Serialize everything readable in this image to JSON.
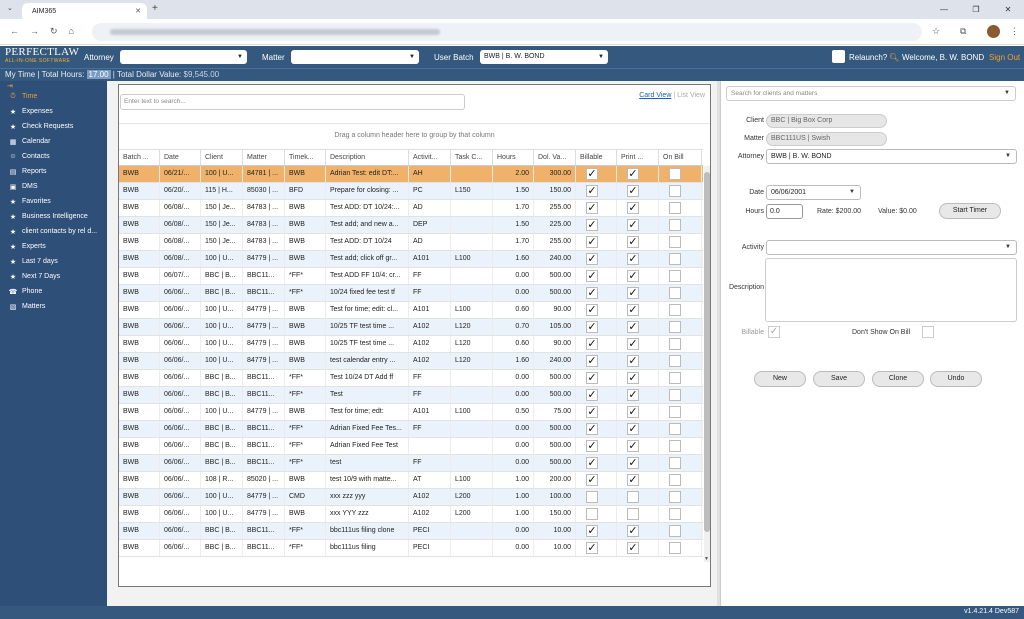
{
  "browser": {
    "tab_title": "AIM365",
    "tab_close": "✕",
    "new_tab": "+",
    "win_min": "—",
    "win_max": "❐",
    "win_close": "✕"
  },
  "header": {
    "logo_main": "PERFECTLAW",
    "logo_sub": "ALL-IN-ONE SOFTWARE",
    "attorney_label": "Attorney",
    "attorney_value": "",
    "matter_label": "Matter",
    "matter_value": "",
    "batch_label": "User Batch",
    "batch_value": "BWB | B. W. BOND",
    "relaunch_label": "Relaunch?",
    "welcome": "Welcome, B. W. BOND",
    "signout": "Sign Out"
  },
  "summary": {
    "text1": "My Time | Total Hours:",
    "hours": "17.00",
    "text2": "| Total Dollar Value:",
    "dollar": "$9,545.00"
  },
  "sidebar": {
    "items": [
      {
        "label": "Time",
        "icon": "clock-icon"
      },
      {
        "label": "Expenses",
        "icon": "star-icon"
      },
      {
        "label": "Check Requests",
        "icon": "star-icon"
      },
      {
        "label": "Calendar",
        "icon": "calendar-icon"
      },
      {
        "label": "Contacts",
        "icon": "contacts-icon"
      },
      {
        "label": "Reports",
        "icon": "reports-icon"
      },
      {
        "label": "DMS",
        "icon": "dms-icon"
      },
      {
        "label": "Favorites",
        "icon": "star-icon"
      },
      {
        "label": "Business Intelligence",
        "icon": "star-icon"
      },
      {
        "label": "client contacts by rel d...",
        "icon": "star-icon"
      },
      {
        "label": "Experts",
        "icon": "star-icon"
      },
      {
        "label": "Last 7 days",
        "icon": "star-icon"
      },
      {
        "label": "Next 7 Days",
        "icon": "star-icon"
      },
      {
        "label": "Phone",
        "icon": "phone-icon"
      },
      {
        "label": "Matters",
        "icon": "matters-icon"
      }
    ]
  },
  "grid": {
    "search_placeholder": "Enter text to search...",
    "card_view": "Card View",
    "list_view": "List View",
    "group_hint": "Drag a column header here to group by that column",
    "columns": [
      "Batch ...",
      "Date",
      "Client",
      "Matter",
      "Timek...",
      "Description",
      "Activit...",
      "Task C...",
      "Hours",
      "Dol. Va...",
      "Billable",
      "Print ...",
      "On Bill"
    ],
    "rows": [
      [
        "BWB",
        "06/21/...",
        "100 | U...",
        "84781 | ...",
        "BWB",
        "Adrian Test: edit DT:...",
        "AH",
        "",
        "2.00",
        "300.00",
        true,
        true,
        false
      ],
      [
        "BWB",
        "06/20/...",
        "115 | H...",
        "85030 | ...",
        "BFD",
        "Prepare for closing: ...",
        "PC",
        "L150",
        "1.50",
        "150.00",
        true,
        true,
        false
      ],
      [
        "BWB",
        "06/08/...",
        "150 | Je...",
        "84783 | ...",
        "BWB",
        "Test ADD: DT 10/24:...",
        "AD",
        "",
        "1.70",
        "255.00",
        true,
        true,
        false
      ],
      [
        "BWB",
        "06/08/...",
        "150 | Je...",
        "84783 | ...",
        "BWB",
        "Test add; and new a...",
        "DEP",
        "",
        "1.50",
        "225.00",
        true,
        true,
        false
      ],
      [
        "BWB",
        "06/08/...",
        "150 | Je...",
        "84783 | ...",
        "BWB",
        "Test ADD: DT 10/24",
        "AD",
        "",
        "1.70",
        "255.00",
        true,
        true,
        false
      ],
      [
        "BWB",
        "06/08/...",
        "100 | U...",
        "84779 | ...",
        "BWB",
        "Test add; click off gr...",
        "A101",
        "L100",
        "1.60",
        "240.00",
        true,
        true,
        false
      ],
      [
        "BWB",
        "06/07/...",
        "BBC | B...",
        "BBC11...",
        "*FF*",
        "Test ADD FF 10/4: cr...",
        "FF",
        "",
        "0.00",
        "500.00",
        true,
        true,
        false
      ],
      [
        "BWB",
        "06/06/...",
        "BBC | B...",
        "BBC11...",
        "*FF*",
        "10/24 fixed fee test tf",
        "FF",
        "",
        "0.00",
        "500.00",
        true,
        true,
        false
      ],
      [
        "BWB",
        "06/06/...",
        "100 | U...",
        "84779 | ...",
        "BWB",
        "Test for time; edit: cl...",
        "A101",
        "L100",
        "0.60",
        "90.00",
        true,
        true,
        false
      ],
      [
        "BWB",
        "06/06/...",
        "100 | U...",
        "84779 | ...",
        "BWB",
        "10/25 TF test time ...",
        "A102",
        "L120",
        "0.70",
        "105.00",
        true,
        true,
        false
      ],
      [
        "BWB",
        "06/06/...",
        "100 | U...",
        "84779 | ...",
        "BWB",
        "10/25 TF test time ...",
        "A102",
        "L120",
        "0.60",
        "90.00",
        true,
        true,
        false
      ],
      [
        "BWB",
        "06/06/...",
        "100 | U...",
        "84779 | ...",
        "BWB",
        "test calendar entry ...",
        "A102",
        "L120",
        "1.60",
        "240.00",
        true,
        true,
        false
      ],
      [
        "BWB",
        "06/06/...",
        "BBC | B...",
        "BBC11...",
        "*FF*",
        "Test 10/24 DT Add ff",
        "FF",
        "",
        "0.00",
        "500.00",
        true,
        true,
        false
      ],
      [
        "BWB",
        "06/06/...",
        "BBC | B...",
        "BBC11...",
        "*FF*",
        "Test",
        "FF",
        "",
        "0.00",
        "500.00",
        true,
        true,
        false
      ],
      [
        "BWB",
        "06/06/...",
        "100 | U...",
        "84779 | ...",
        "BWB",
        "Test for time; edt:",
        "A101",
        "L100",
        "0.50",
        "75.00",
        true,
        true,
        false
      ],
      [
        "BWB",
        "06/06/...",
        "BBC | B...",
        "BBC11...",
        "*FF*",
        "Adrian Fixed Fee Tes...",
        "FF",
        "",
        "0.00",
        "500.00",
        true,
        true,
        false
      ],
      [
        "BWB",
        "06/06/...",
        "BBC | B...",
        "BBC11...",
        "*FF*",
        "Adrian Fixed Fee Test",
        "",
        "",
        "0.00",
        "500.00",
        true,
        true,
        false
      ],
      [
        "BWB",
        "06/06/...",
        "BBC | B...",
        "BBC11...",
        "*FF*",
        "test",
        "FF",
        "",
        "0.00",
        "500.00",
        true,
        true,
        false
      ],
      [
        "BWB",
        "06/06/...",
        "108 | R...",
        "85020 | ...",
        "BWB",
        "test 10/9 with matte...",
        "AT",
        "L100",
        "1.00",
        "200.00",
        true,
        true,
        false
      ],
      [
        "BWB",
        "06/06/...",
        "100 | U...",
        "84779 | ...",
        "CMD",
        "xxx zzz yyy",
        "A102",
        "L200",
        "1.00",
        "100.00",
        false,
        false,
        false
      ],
      [
        "BWB",
        "06/06/...",
        "100 | U...",
        "84779 | ...",
        "BWB",
        "xxx YYY zzz",
        "A102",
        "L200",
        "1.00",
        "150.00",
        false,
        false,
        false
      ],
      [
        "BWB",
        "06/06/...",
        "BBC | B...",
        "BBC11...",
        "*FF*",
        "bbc111us filing clone",
        "PECI",
        "",
        "0.00",
        "10.00",
        true,
        true,
        false
      ],
      [
        "BWB",
        "06/06/...",
        "BBC | B...",
        "BBC11...",
        "*FF*",
        "bbc111us filing",
        "PECI",
        "",
        "0.00",
        "10.00",
        true,
        true,
        false
      ]
    ]
  },
  "entry": {
    "search_placeholder": "Search for clients and matters",
    "client_label": "Client",
    "client_value": "BBC | Big Box Corp",
    "matter_label": "Matter",
    "matter_value": "BBC111US | Swish",
    "attorney_label": "Attorney",
    "attorney_value": "BWB | B. W. BOND",
    "date_label": "Date",
    "date_value": "06/06/2001",
    "hours_label": "Hours",
    "hours_value": "0.0",
    "rate_text": "Rate: $200.00",
    "value_text": "Value: $0.00",
    "start_timer": "Start Timer",
    "activity_label": "Activity",
    "activity_value": "",
    "description_label": "Description",
    "billable_label": "Billable",
    "dont_show_label": "Don't Show On Bill",
    "btn_new": "New",
    "btn_save": "Save",
    "btn_clone": "Clone",
    "btn_undo": "Undo"
  },
  "footer": {
    "version": "v1.4.21.4 Dev587"
  }
}
